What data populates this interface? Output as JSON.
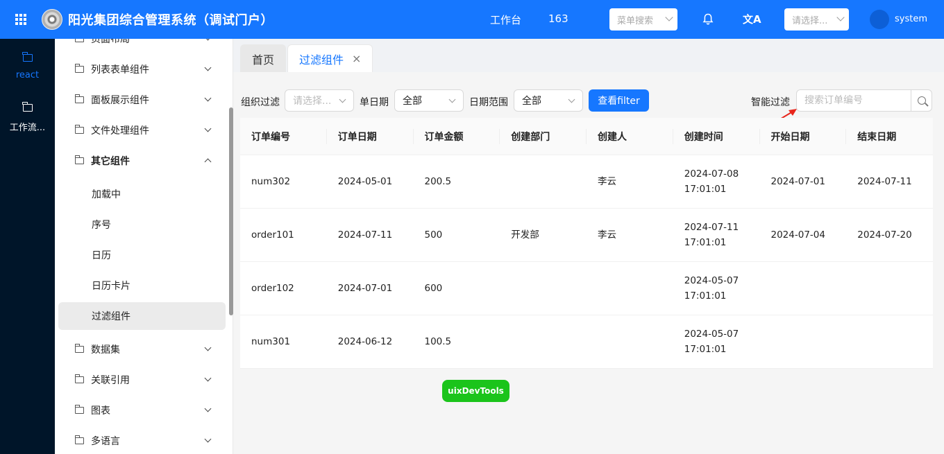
{
  "header": {
    "title": "阳光集团综合管理系统（调试门户）",
    "workbench": "工作台",
    "count": "163",
    "menu_search_placeholder": "菜单搜索",
    "lang_placeholder": "请选择...",
    "translate_glyph": "文A",
    "username": "system"
  },
  "rail": {
    "items": [
      {
        "label": "react",
        "active": true
      },
      {
        "label": "工作流..."
      }
    ]
  },
  "submenu": {
    "top_partial": "页面布局",
    "items": [
      {
        "label": "列表表单组件"
      },
      {
        "label": "面板展示组件"
      },
      {
        "label": "文件处理组件"
      },
      {
        "label": "其它组件"
      }
    ],
    "children": [
      {
        "label": "加载中"
      },
      {
        "label": "序号"
      },
      {
        "label": "日历"
      },
      {
        "label": "日历卡片"
      },
      {
        "label": "过滤组件"
      }
    ],
    "after": [
      {
        "label": "数据集"
      },
      {
        "label": "关联引用"
      },
      {
        "label": "图表"
      },
      {
        "label": "多语言"
      }
    ]
  },
  "tabs": [
    {
      "label": "首页"
    },
    {
      "label": "过滤组件",
      "close": "×"
    }
  ],
  "filters": {
    "org_label": "组织过滤",
    "org_placeholder": "请选择...",
    "date_label": "单日期",
    "date_value": "全部",
    "range_label": "日期范围",
    "range_value": "全部",
    "query_button": "查看filter",
    "smart_label": "智能过滤",
    "smart_placeholder": "搜索订单编号"
  },
  "table": {
    "headers": [
      "订单编号",
      "订单日期",
      "订单金额",
      "创建部门",
      "创建人",
      "创建时间",
      "开始日期",
      "结束日期"
    ],
    "rows": [
      {
        "no": "num302",
        "date": "2024-05-01",
        "amount": "200.5",
        "dept": "",
        "creator": "李云",
        "time_date": "2024-07-08",
        "time_clock": "17:01:01",
        "start": "2024-07-01",
        "end": "2024-07-11"
      },
      {
        "no": "order101",
        "date": "2024-07-11",
        "amount": "500",
        "dept": "开发部",
        "creator": "李云",
        "time_date": "2024-07-11",
        "time_clock": "17:01:01",
        "start": "2024-07-04",
        "end": "2024-07-20"
      },
      {
        "no": "order102",
        "date": "2024-07-01",
        "amount": "600",
        "dept": "",
        "creator": "",
        "time_date": "2024-05-07",
        "time_clock": "17:01:01",
        "start": "",
        "end": ""
      },
      {
        "no": "num301",
        "date": "2024-06-12",
        "amount": "100.5",
        "dept": "",
        "creator": "",
        "time_date": "2024-05-07",
        "time_clock": "17:01:01",
        "start": "",
        "end": ""
      }
    ]
  },
  "devtools_label": "uixDevTools"
}
